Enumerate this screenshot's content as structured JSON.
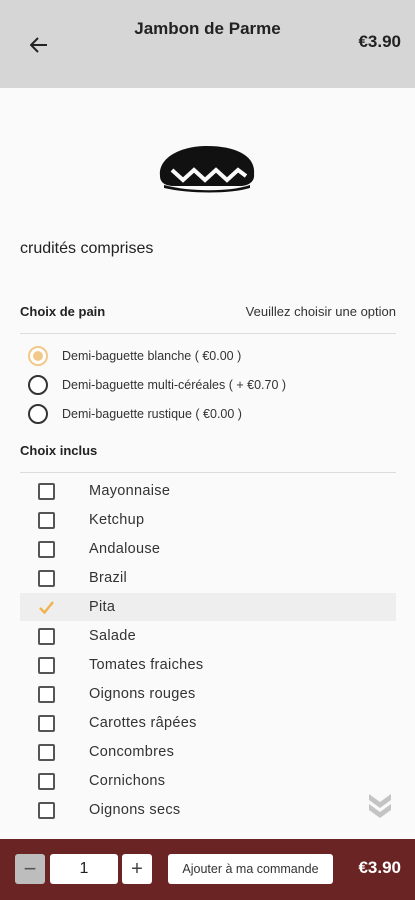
{
  "header": {
    "title": "Jambon de Parme",
    "price": "€3.90"
  },
  "product": {
    "description": "crudités comprises",
    "image_icon": "sandwich-icon"
  },
  "bread_section": {
    "title": "Choix de pain",
    "hint": "Veuillez choisir une option",
    "options": [
      {
        "label": "Demi-baguette blanche ( €0.00 )",
        "selected": true
      },
      {
        "label": "Demi-baguette multi-céréales ( + €0.70 )",
        "selected": false
      },
      {
        "label": "Demi-baguette rustique ( €0.00 )",
        "selected": false
      }
    ]
  },
  "included_section": {
    "title": "Choix inclus",
    "options": [
      {
        "label": "Mayonnaise",
        "checked": false
      },
      {
        "label": "Ketchup",
        "checked": false
      },
      {
        "label": "Andalouse",
        "checked": false
      },
      {
        "label": "Brazil",
        "checked": false
      },
      {
        "label": "Pita",
        "checked": true
      },
      {
        "label": "Salade",
        "checked": false
      },
      {
        "label": "Tomates fraiches",
        "checked": false
      },
      {
        "label": "Oignons rouges",
        "checked": false
      },
      {
        "label": "Carottes râpées",
        "checked": false
      },
      {
        "label": "Concombres",
        "checked": false
      },
      {
        "label": "Cornichons",
        "checked": false
      },
      {
        "label": "Oignons secs",
        "checked": false
      }
    ]
  },
  "footer": {
    "minus": "−",
    "quantity": "1",
    "plus": "+",
    "add_label": "Ajouter à ma commande",
    "price": "€3.90"
  },
  "colors": {
    "accent": "#f2c88a",
    "footer_bg": "#6b2424",
    "header_bg": "#d6d6d6"
  }
}
